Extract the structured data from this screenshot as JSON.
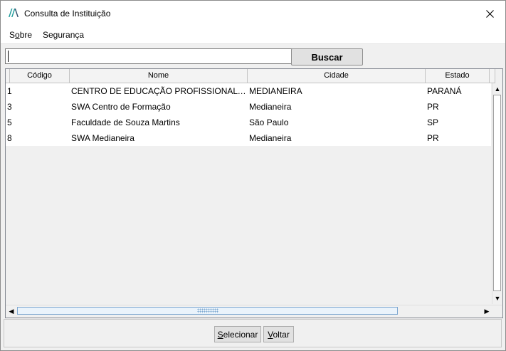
{
  "window": {
    "title": "Consulta de Instituição",
    "icon": "app-logo-icon",
    "close_icon": "close-icon"
  },
  "menu": [
    {
      "label": "Sobre",
      "mnemonic": "o"
    },
    {
      "label": "Segurança"
    }
  ],
  "search": {
    "value": "",
    "placeholder": "",
    "button_label": "Buscar"
  },
  "table": {
    "columns": [
      "Código",
      "Nome",
      "Cidade",
      "Estado"
    ],
    "rows": [
      {
        "codigo": "1",
        "nome": "CENTRO DE EDUCAÇÃO PROFISSIONAL MEDIANEIRA",
        "cidade": "MEDIANEIRA",
        "estado": "PARANÁ"
      },
      {
        "codigo": "3",
        "nome": "SWA Centro de Formação",
        "cidade": "Medianeira",
        "estado": "PR"
      },
      {
        "codigo": "5",
        "nome": "Faculdade de Souza Martins",
        "cidade": "São Paulo",
        "estado": "SP"
      },
      {
        "codigo": "8",
        "nome": "SWA Medianeira",
        "cidade": "Medianeira",
        "estado": "PR"
      }
    ]
  },
  "footer": {
    "select_label": "Selecionar",
    "back_label": "Voltar"
  },
  "colors": {
    "accent": "#1e9b9b",
    "scroll_thumb_border": "#7fa8d1",
    "scroll_thumb_fill": "#eaf3fb"
  }
}
